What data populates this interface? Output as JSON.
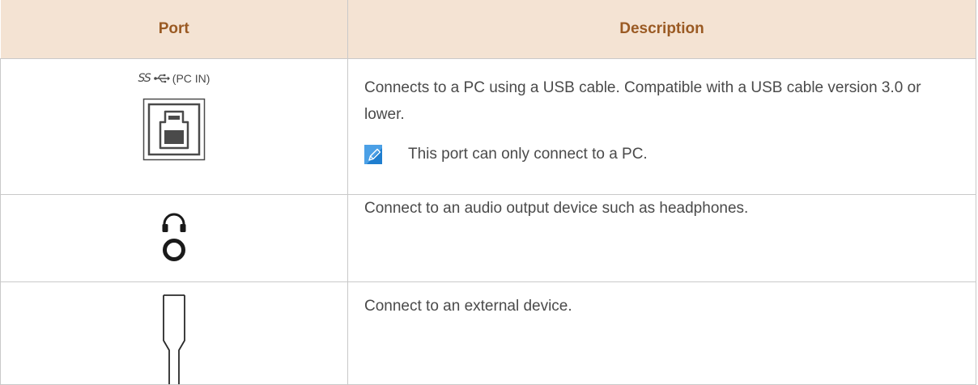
{
  "table": {
    "headers": {
      "port": "Port",
      "description": "Description"
    },
    "rows": [
      {
        "port_label": "(PC IN)",
        "port_prefix": "SS",
        "port_icon": "usb-3-b-port-icon",
        "description": "Connects to a PC using a USB cable. Compatible with a USB cable version 3.0 or lower.",
        "note_icon": "note-pencil-icon",
        "note": "This port can only connect to a PC."
      },
      {
        "port_icon": "headphone-jack-icon",
        "description": "Connect to an audio output device such as headphones."
      },
      {
        "port_icon": "external-connector-icon",
        "description": "Connect to an external device."
      }
    ]
  },
  "colors": {
    "header_background": "#f4e3d3",
    "header_text": "#9a5a23",
    "note_icon_blue": "#1f7ecf",
    "border": "#c9c9c9"
  }
}
